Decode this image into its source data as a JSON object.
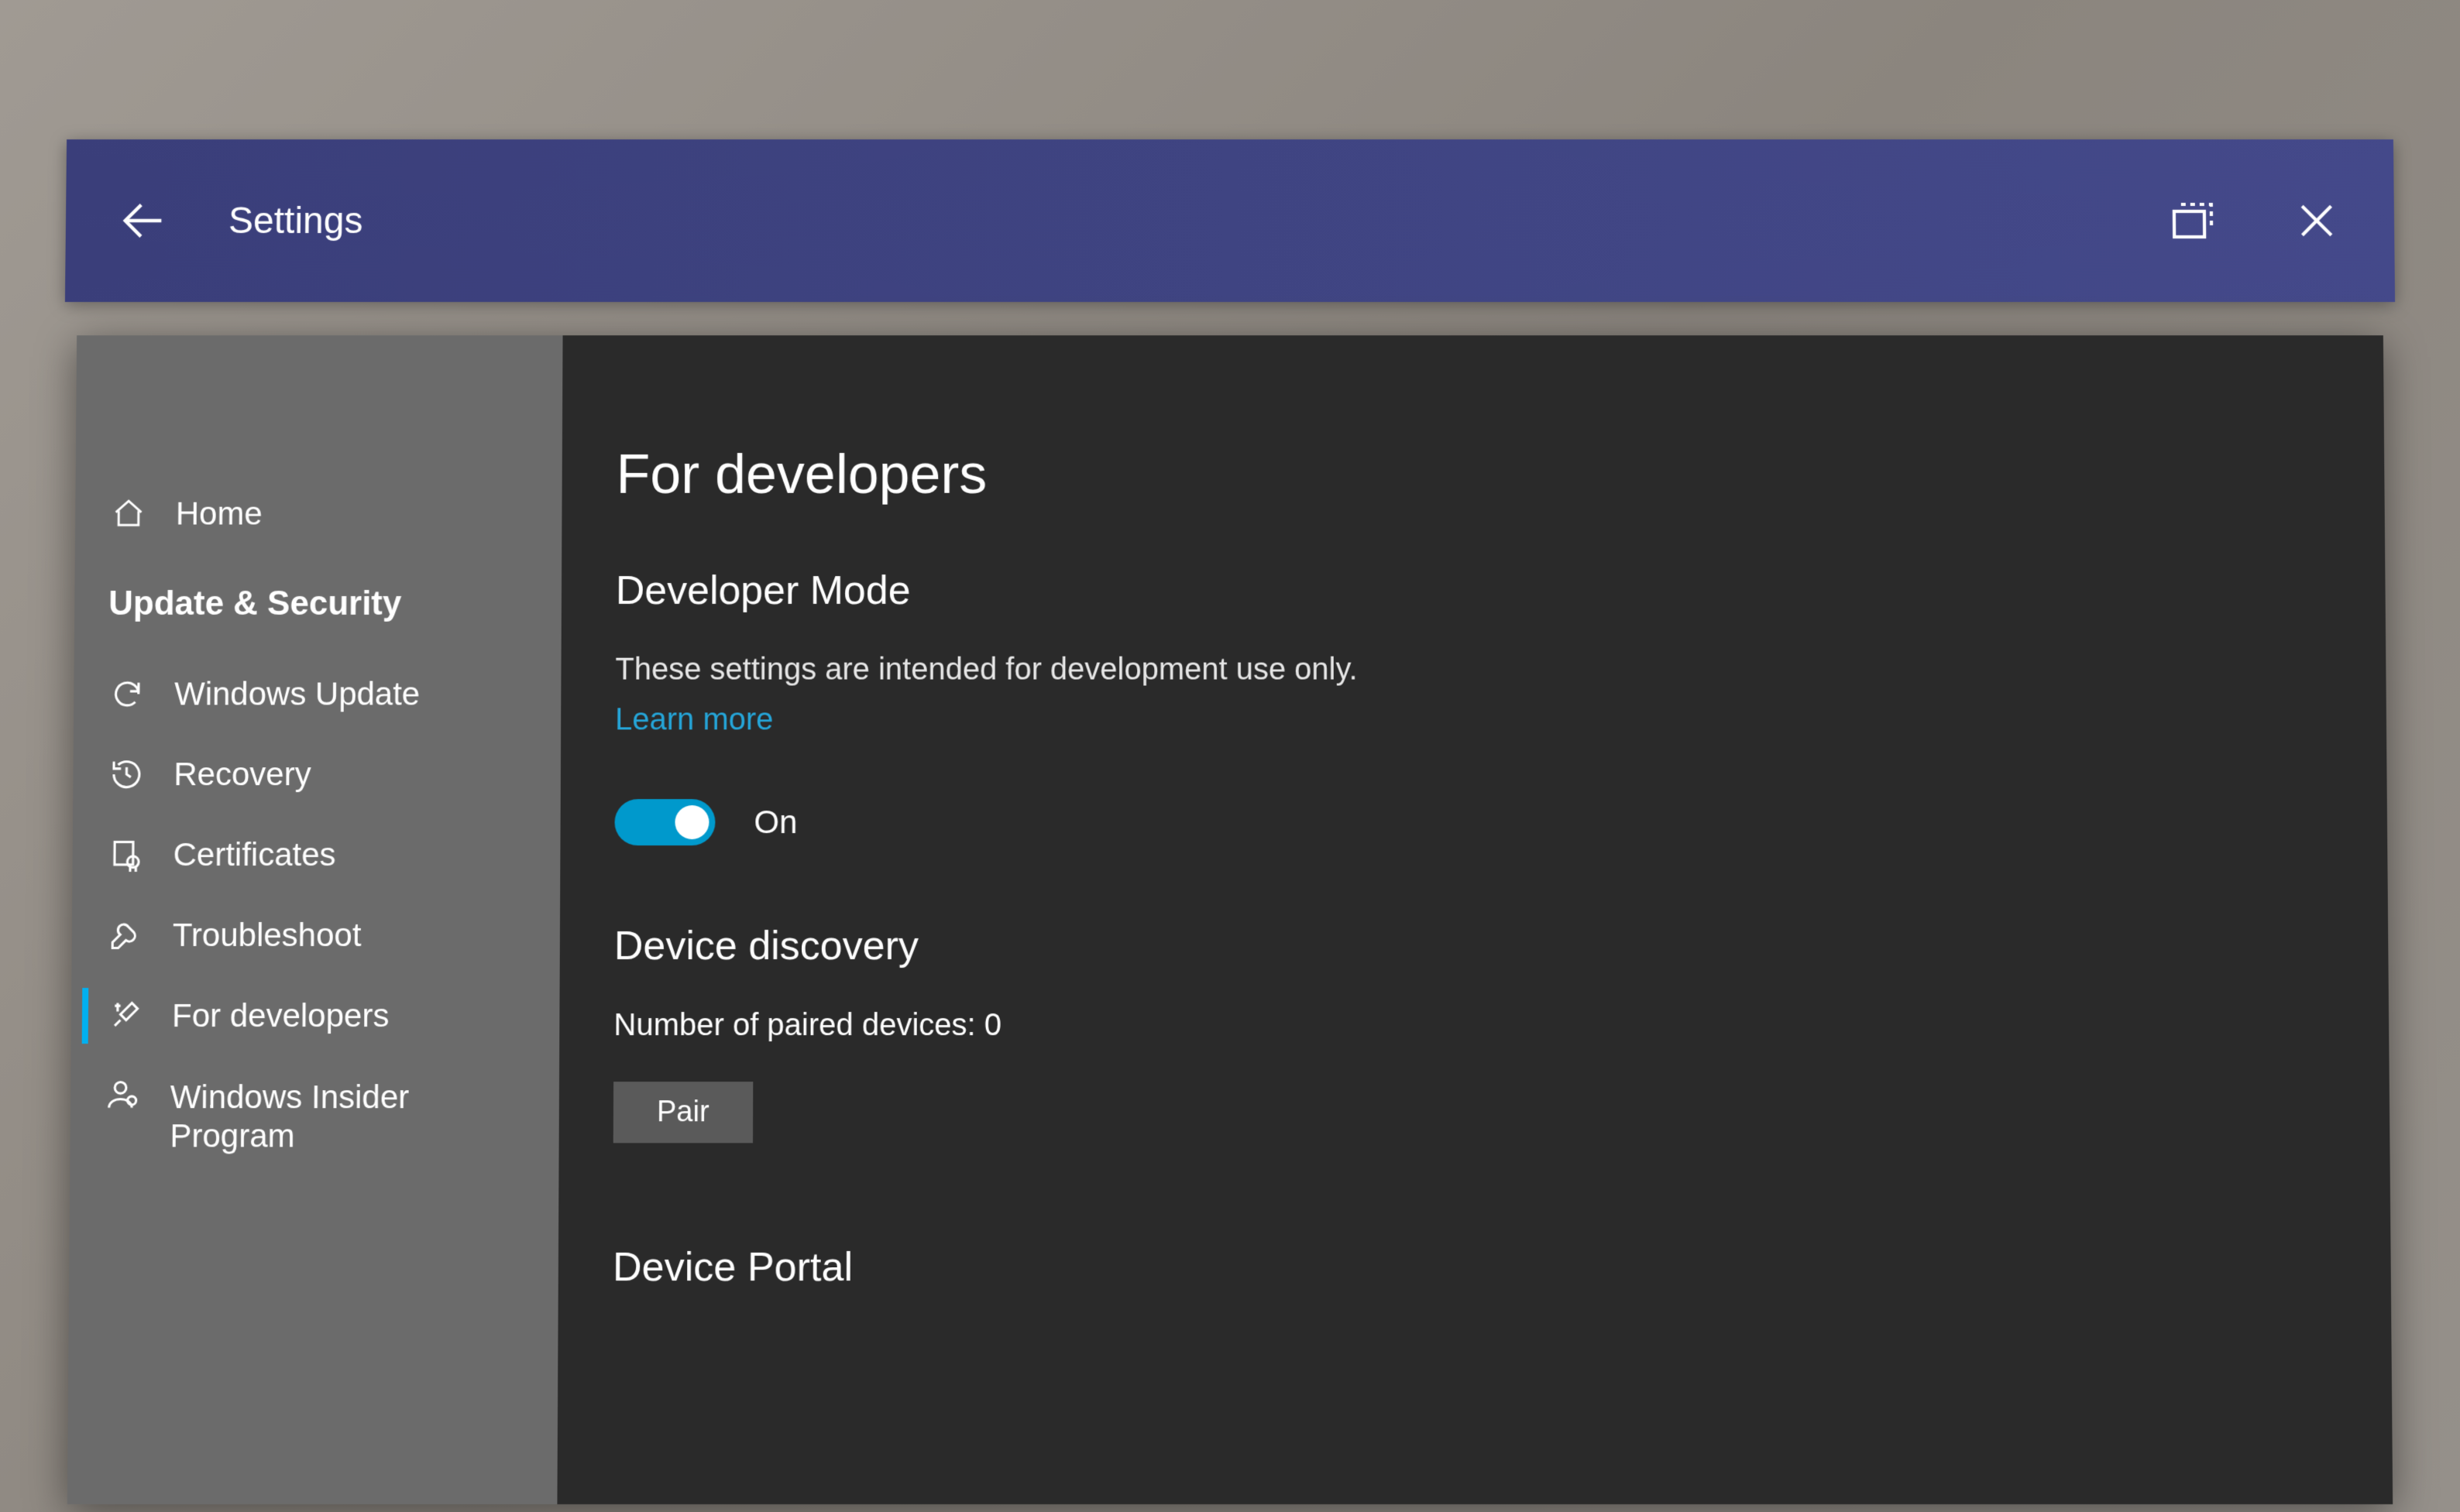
{
  "titlebar": {
    "title": "Settings"
  },
  "sidebar": {
    "home": "Home",
    "category": "Update & Security",
    "items": [
      {
        "label": "Windows Update"
      },
      {
        "label": "Recovery"
      },
      {
        "label": "Certificates"
      },
      {
        "label": "Troubleshoot"
      },
      {
        "label": "For developers"
      },
      {
        "label": "Windows Insider Program"
      }
    ]
  },
  "content": {
    "page_title": "For developers",
    "section1": {
      "heading": "Developer Mode",
      "description": "These settings are intended for development use only.",
      "learn_more": "Learn more",
      "toggle_state": "On"
    },
    "section2": {
      "heading": "Device discovery",
      "paired_text": "Number of paired devices: 0",
      "pair_button": "Pair"
    },
    "section3": {
      "heading": "Device Portal"
    }
  }
}
